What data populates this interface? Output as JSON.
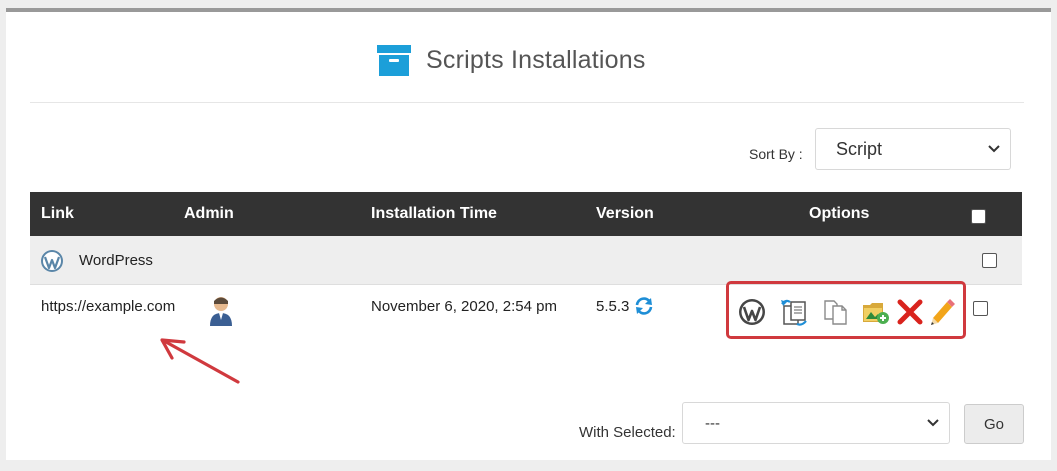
{
  "header": {
    "title": "Scripts Installations",
    "icon": "archive-box-icon",
    "accent": "#1c9fd9"
  },
  "sort": {
    "label": "Sort By :",
    "selected": "Script"
  },
  "table": {
    "columns": {
      "link": "Link",
      "admin": "Admin",
      "installation_time": "Installation Time",
      "version": "Version",
      "options": "Options"
    },
    "group": {
      "name": "WordPress",
      "icon": "wordpress-logo-icon"
    },
    "rows": [
      {
        "link": "https://example.com",
        "admin_icon": "admin-user-icon",
        "installation_time": "November 6, 2020, 2:54 pm",
        "version": "5.5.3",
        "version_icon": "upgrade-refresh-icon",
        "options": [
          "wordpress-manage-icon",
          "backup-icon",
          "clone-icon",
          "staging-icon",
          "remove-icon",
          "edit-icon"
        ]
      }
    ]
  },
  "footer": {
    "with_selected_label": "With Selected:",
    "with_selected_value": "---",
    "go_label": "Go"
  },
  "colors": {
    "table_header": "#333333",
    "highlight_box": "#d0393e",
    "annotation_arrow": "#d0393e"
  }
}
